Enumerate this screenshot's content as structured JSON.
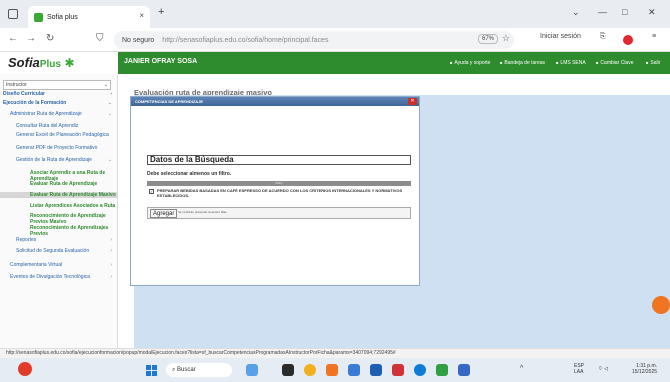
{
  "browser": {
    "tab_title": "Sofia plus",
    "tab_close": "×",
    "new_tab": "+",
    "security_label": "No seguro",
    "url": "http://senasofiaplus.edu.co/sofia/home/principal.faces",
    "zoom": "67%",
    "signin_label": "Iniciar sesión",
    "win_min": "—",
    "win_max": "□",
    "win_close": "✕",
    "chevron": "⌄"
  },
  "header": {
    "logo_text": "Sofia",
    "logo_plus": "Plus",
    "user_name": "JANIER OFRAY SOSA",
    "menu": [
      "Ayuda y soporte",
      "Bandeja de tareas",
      "LMS SENA",
      "Cambiar Clave",
      "Salir"
    ]
  },
  "sidebar": {
    "role": "Instructor",
    "items": [
      {
        "label": "Diseño Curricular",
        "style": "bold ind0",
        "arrow": "›"
      },
      {
        "label": "Ejecución de la Formación",
        "style": "bold ind0",
        "arrow": "⌄"
      },
      {
        "label": "Administrar Ruta de Aprendizaje",
        "style": "ind1",
        "arrow": "⌄"
      },
      {
        "label": "Consultar Ruta del Aprendiz",
        "style": "ind2",
        "arrow": ""
      },
      {
        "label": "Generar Excel de Planeación Pedagógica",
        "style": "ind2",
        "arrow": ""
      },
      {
        "label": "Generar PDF de Proyecto Formativo",
        "style": "ind2",
        "arrow": ""
      },
      {
        "label": "Gestión de la Ruta de Aprendizaje",
        "style": "ind2",
        "arrow": "⌄"
      },
      {
        "label": "Asociar Aprendiz a una Ruta de Aprendizaje",
        "style": "green ind3",
        "arrow": ""
      },
      {
        "label": "Evaluar Ruta de Aprendizaje",
        "style": "green ind3",
        "arrow": ""
      },
      {
        "label": "Evaluar Ruta de Aprendizaje Masivo",
        "style": "green ind3 active",
        "arrow": ""
      },
      {
        "label": "Listar Aprendices Asociados a Ruta",
        "style": "green ind3",
        "arrow": ""
      },
      {
        "label": "Reconocimiento de Aprendizaje Previos Masivo",
        "style": "green ind3",
        "arrow": ""
      },
      {
        "label": "Reconocimiento de Aprendizajes Previos",
        "style": "green ind3",
        "arrow": ""
      },
      {
        "label": "Reportes",
        "style": "ind2",
        "arrow": "›"
      },
      {
        "label": "Solicitud de Segunda Evaluación",
        "style": "ind2",
        "arrow": "›"
      },
      {
        "label": "Complementaria Virtual",
        "style": "ind1",
        "arrow": "›"
      },
      {
        "label": "Eventos de Divulgación Tecnológica",
        "style": "ind1",
        "arrow": "›"
      }
    ]
  },
  "main": {
    "title": "Evaluación ruta de aprendizaje masivo"
  },
  "modal": {
    "title": "COMPETENCIAS DE APRENDIZAJE",
    "close": "✕",
    "section_title": "Datos de la Búsqueda",
    "note": "Debe seleccionar almenos un filtro.",
    "filter_bar": "Filtro",
    "competencies": [
      {
        "text": "PREPARAR BEBIDAS BASADAS EN CAFÉ ESPRESSO DE ACUERDO CON LOS CRITERIOS INTERNACIONALES Y NORMATIVOS ESTABLECIDOS.",
        "checked": "✓"
      }
    ],
    "add_button": "Agregar",
    "add_hint": "Se recibirán presionar la acción Mas."
  },
  "status_url": "http://senasofiaplus.edu.co/sofia/ejecucionformacion/popup/modalEjecucion.faces?lista=sf_buscarCompetenciasProgramadasAInstructorPorFicha&params=3407094;7292495#",
  "taskbar": {
    "search_placeholder": "Buscar",
    "lang": "ESP",
    "lang2": "LAA",
    "time": "1:31 p.m.",
    "date": "15/12/2025"
  }
}
